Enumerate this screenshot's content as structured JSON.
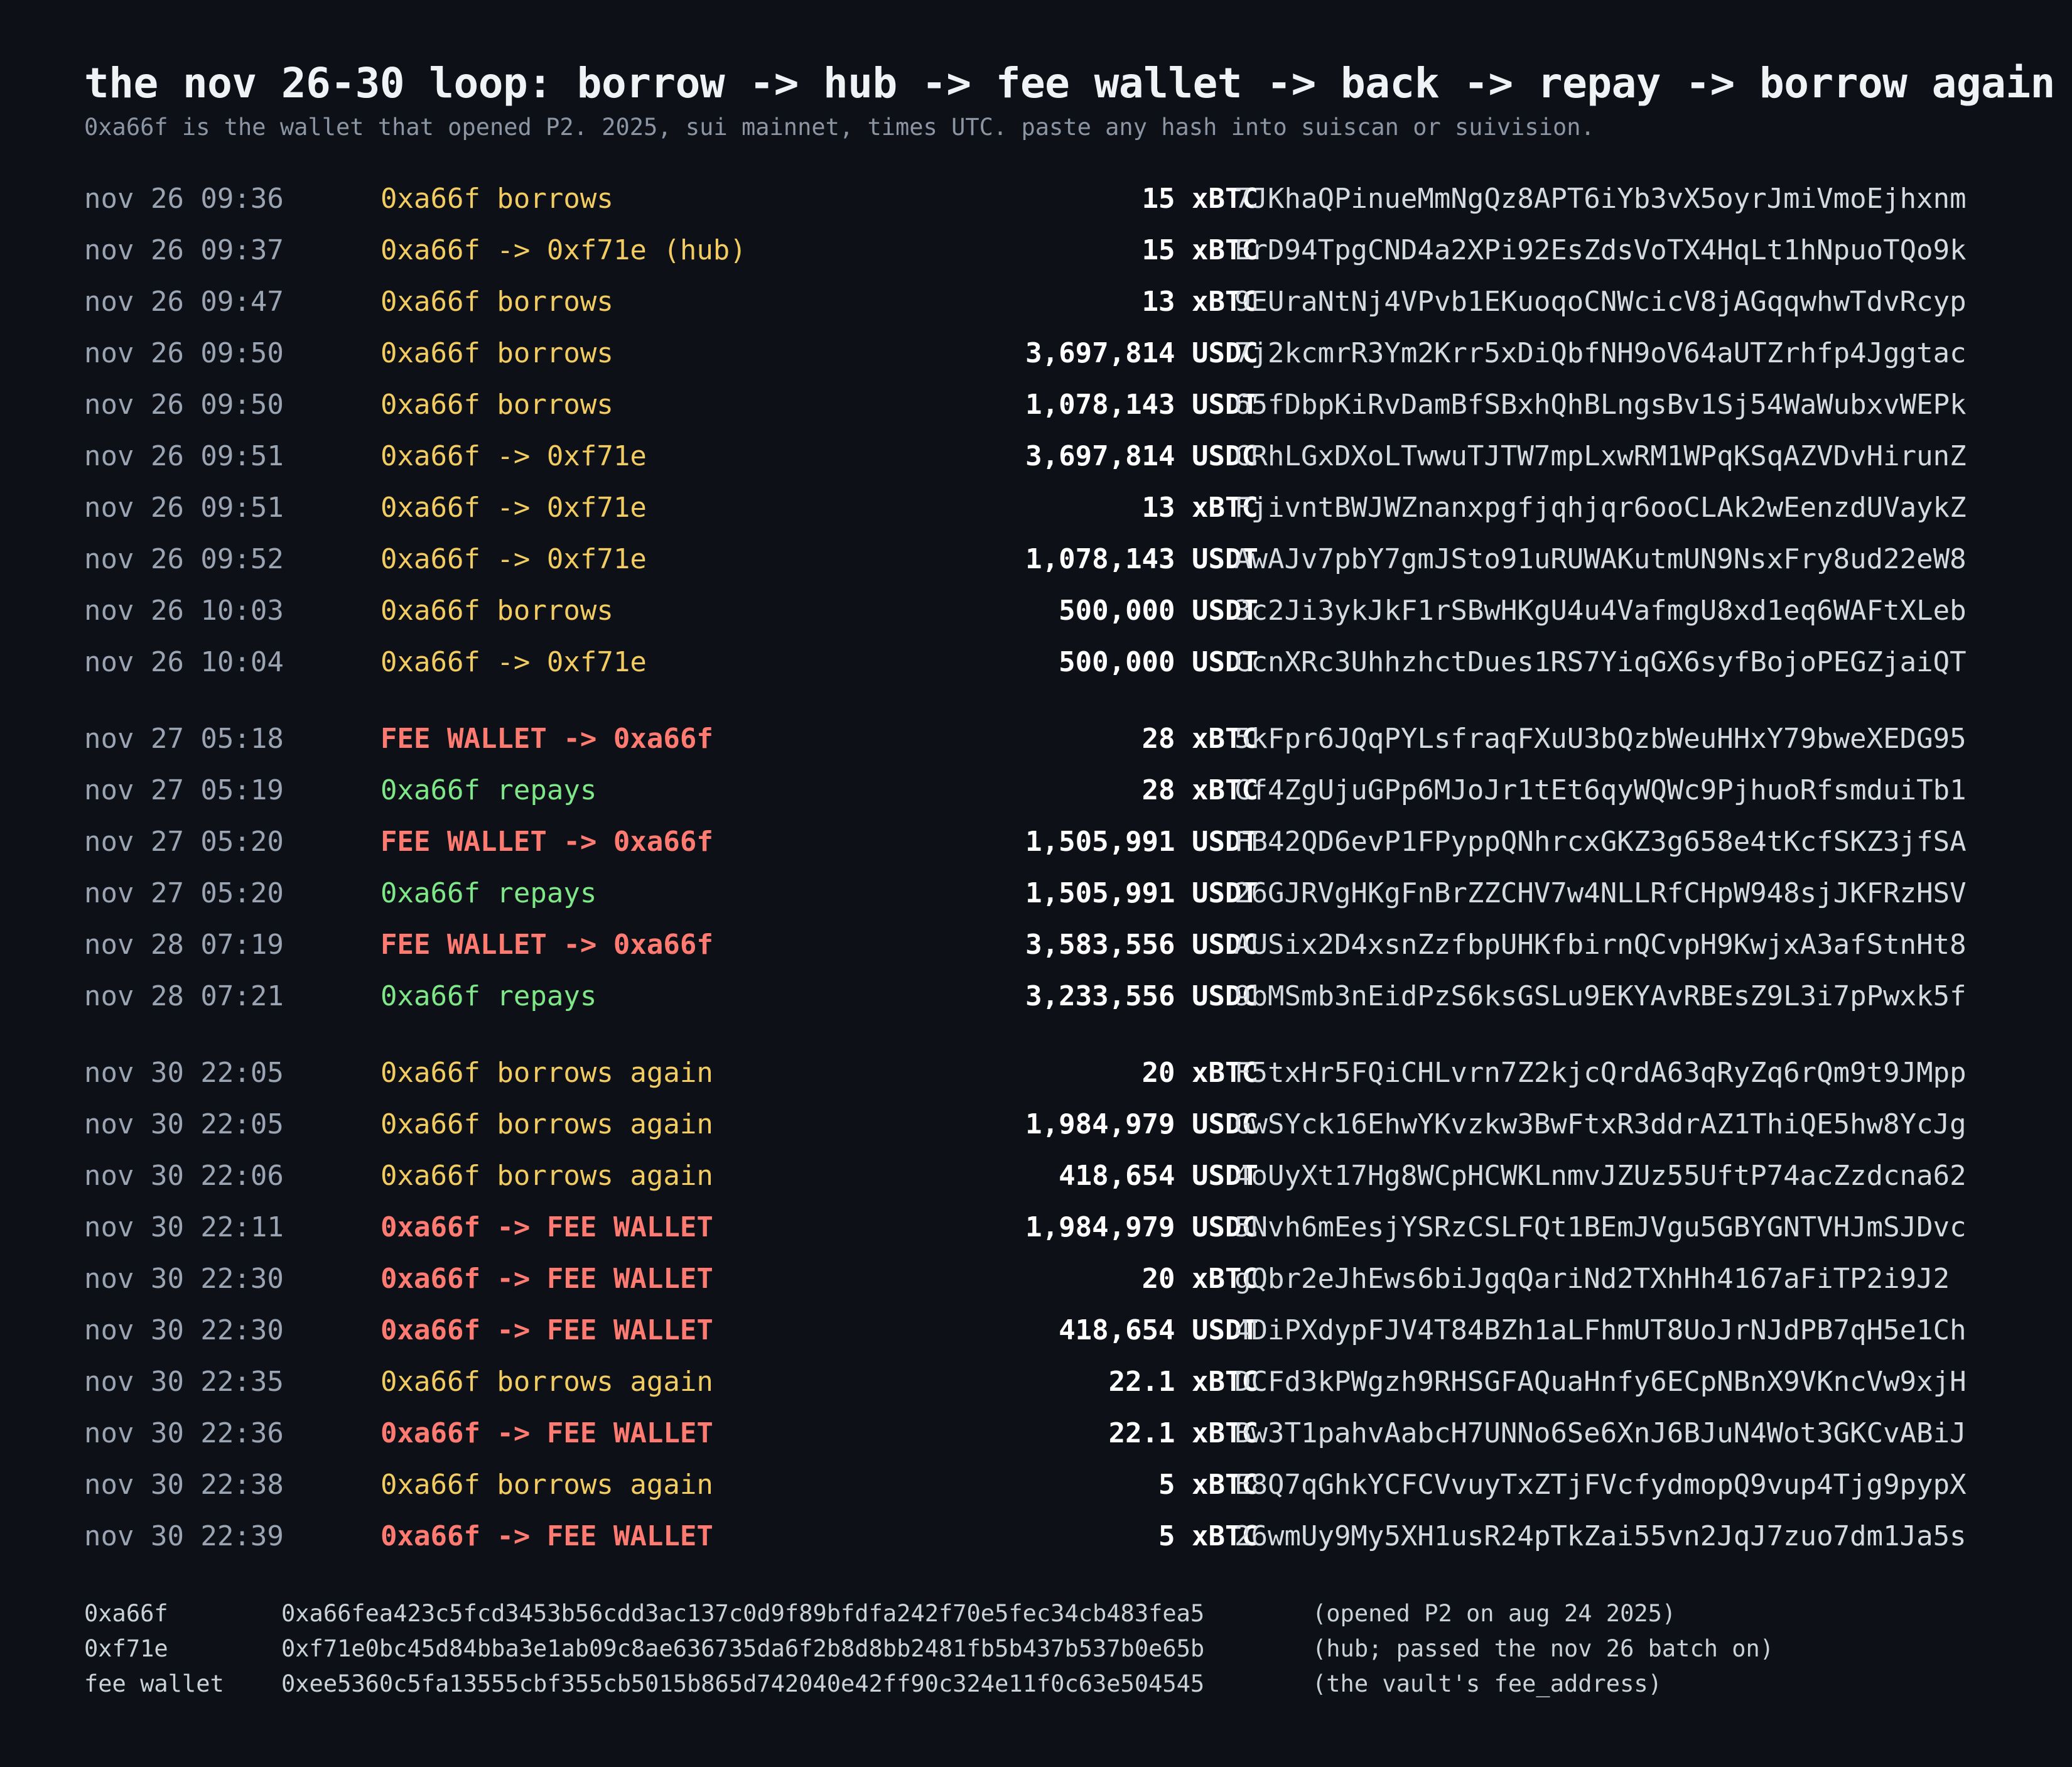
{
  "title": "the nov 26-30 loop: borrow -> hub -> fee wallet -> back -> repay -> borrow again",
  "subtitle": "0xa66f is the wallet that opened P2. 2025, sui mainnet, times UTC. paste any hash into suiscan or suivision.",
  "colors": {
    "background": "#0d1117",
    "borrow": "#f2cc60",
    "repay": "#7ee787",
    "fee_wallet": "#ff7b72",
    "amount": "#ffffff",
    "time": "#9aa4b2"
  },
  "groups": [
    {
      "rows": [
        {
          "time": "nov 26 09:36",
          "desc": "0xa66f borrows",
          "kind": "borrow",
          "amount": "15 xBTC",
          "hash": "7JKhaQPinueMmNgQz8APT6iYb3vX5oyrJmiVmoEjhxnm"
        },
        {
          "time": "nov 26 09:37",
          "desc": "0xa66f -> 0xf71e (hub)",
          "kind": "borrow",
          "amount": "15 xBTC",
          "hash": "ErD94TpgCND4a2XPi92EsZdsVoTX4HqLt1hNpuoTQo9k"
        },
        {
          "time": "nov 26 09:47",
          "desc": "0xa66f borrows",
          "kind": "borrow",
          "amount": "13 xBTC",
          "hash": "9EUraNtNj4VPvb1EKuoqoCNWcicV8jAGqqwhwTdvRcyp"
        },
        {
          "time": "nov 26 09:50",
          "desc": "0xa66f borrows",
          "kind": "borrow",
          "amount": "3,697,814 USDC",
          "hash": "7j2kcmrR3Ym2Krr5xDiQbfNH9oV64aUTZrhfp4Jggtac"
        },
        {
          "time": "nov 26 09:50",
          "desc": "0xa66f borrows",
          "kind": "borrow",
          "amount": "1,078,143 USDT",
          "hash": "65fDbpKiRvDamBfSBxhQhBLngsBv1Sj54WaWubxvWEPk"
        },
        {
          "time": "nov 26 09:51",
          "desc": "0xa66f -> 0xf71e",
          "kind": "borrow",
          "amount": "3,697,814 USDC",
          "hash": "CRhLGxDXoLTwwuTJTW7mpLxwRM1WPqKSqAZVDvHirunZ"
        },
        {
          "time": "nov 26 09:51",
          "desc": "0xa66f -> 0xf71e",
          "kind": "borrow",
          "amount": "13 xBTC",
          "hash": "FjivntBWJWZnanxpgfjqhjqr6ooCLAk2wEenzdUVaykZ"
        },
        {
          "time": "nov 26 09:52",
          "desc": "0xa66f -> 0xf71e",
          "kind": "borrow",
          "amount": "1,078,143 USDT",
          "hash": "AwAJv7pbY7gmJSto91uRUWAKutmUN9NsxFry8ud22eW8"
        },
        {
          "time": "nov 26 10:03",
          "desc": "0xa66f borrows",
          "kind": "borrow",
          "amount": "500,000 USDT",
          "hash": "3c2Ji3ykJkF1rSBwHKgU4u4VafmgU8xd1eq6WAFtXLeb"
        },
        {
          "time": "nov 26 10:04",
          "desc": "0xa66f -> 0xf71e",
          "kind": "borrow",
          "amount": "500,000 USDT",
          "hash": "CcnXRc3UhhzhctDues1RS7YiqGX6syfBojoPEGZjaiQT"
        }
      ]
    },
    {
      "rows": [
        {
          "time": "nov 27 05:18",
          "desc": "FEE WALLET -> 0xa66f",
          "kind": "fee",
          "amount": "28 xBTC",
          "hash": "5kFpr6JQqPYLsfraqFXuU3bQzbWeuHHxY79bweXEDG95"
        },
        {
          "time": "nov 27 05:19",
          "desc": "0xa66f repays",
          "kind": "repay",
          "amount": "28 xBTC",
          "hash": "Cf4ZgUjuGPp6MJoJr1tEt6qyWQWc9PjhuoRfsmduiTb1"
        },
        {
          "time": "nov 27 05:20",
          "desc": "FEE WALLET -> 0xa66f",
          "kind": "fee",
          "amount": "1,505,991 USDT",
          "hash": "FB42QD6evP1FPyppQNhrcxGKZ3g658e4tKcfSKZ3jfSA"
        },
        {
          "time": "nov 27 05:20",
          "desc": "0xa66f repays",
          "kind": "repay",
          "amount": "1,505,991 USDT",
          "hash": "26GJRVgHKgFnBrZZCHV7w4NLLRfCHpW948sjJKFRzHSV"
        },
        {
          "time": "nov 28 07:19",
          "desc": "FEE WALLET -> 0xa66f",
          "kind": "fee",
          "amount": "3,583,556 USDC",
          "hash": "AUSix2D4xsnZzfbpUHKfbirnQCvpH9KwjxA3afStnHt8"
        },
        {
          "time": "nov 28 07:21",
          "desc": "0xa66f repays",
          "kind": "repay",
          "amount": "3,233,556 USDC",
          "hash": "9bMSmb3nEidPzS6ksGSLu9EKYAvRBEsZ9L3i7pPwxk5f"
        }
      ]
    },
    {
      "rows": [
        {
          "time": "nov 30 22:05",
          "desc": "0xa66f borrows again",
          "kind": "borrow",
          "amount": "20 xBTC",
          "hash": "F5txHr5FQiCHLvrn7Z2kjcQrdA63qRyZq6rQm9t9JMpp"
        },
        {
          "time": "nov 30 22:05",
          "desc": "0xa66f borrows again",
          "kind": "borrow",
          "amount": "1,984,979 USDC",
          "hash": "GwSYck16EhwYKvzkw3BwFtxR3ddrAZ1ThiQE5hw8YcJg"
        },
        {
          "time": "nov 30 22:06",
          "desc": "0xa66f borrows again",
          "kind": "borrow",
          "amount": "418,654 USDT",
          "hash": "4oUyXt17Hg8WCpHCWKLnmvJZUz55UftP74acZzdcna62"
        },
        {
          "time": "nov 30 22:11",
          "desc": "0xa66f -> FEE WALLET",
          "kind": "fee",
          "amount": "1,984,979 USDC",
          "hash": "5Nvh6mEesjYSRzCSLFQt1BEmJVgu5GBYGNTVHJmSJDvc"
        },
        {
          "time": "nov 30 22:30",
          "desc": "0xa66f -> FEE WALLET",
          "kind": "fee",
          "amount": "20 xBTC",
          "hash": "gQbr2eJhEws6biJgqQariNd2TXhHh4167aFiTP2i9J2"
        },
        {
          "time": "nov 30 22:30",
          "desc": "0xa66f -> FEE WALLET",
          "kind": "fee",
          "amount": "418,654 USDT",
          "hash": "4DiPXdypFJV4T84BZh1aLFhmUT8UoJrNJdPB7qH5e1Ch"
        },
        {
          "time": "nov 30 22:35",
          "desc": "0xa66f borrows again",
          "kind": "borrow",
          "amount": "22.1 xBTC",
          "hash": "DCFd3kPWgzh9RHSGFAQuaHnfy6ECpNBnX9VKncVw9xjH"
        },
        {
          "time": "nov 30 22:36",
          "desc": "0xa66f -> FEE WALLET",
          "kind": "fee",
          "amount": "22.1 xBTC",
          "hash": "Bw3T1pahvAabcH7UNNo6Se6XnJ6BJuN4Wot3GKCvABiJ"
        },
        {
          "time": "nov 30 22:38",
          "desc": "0xa66f borrows again",
          "kind": "borrow",
          "amount": "5 xBTC",
          "hash": "E8Q7qGhkYCFCVvuyTxZTjFVcfydmopQ9vup4Tjg9pypX"
        },
        {
          "time": "nov 30 22:39",
          "desc": "0xa66f -> FEE WALLET",
          "kind": "fee",
          "amount": "5 xBTC",
          "hash": "26wmUy9My5XH1usR24pTkZai55vn2JqJ7zuo7dm1Ja5s"
        }
      ]
    }
  ],
  "legend": [
    {
      "label": "0xa66f",
      "address": "0xa66fea423c5fcd3453b56cdd3ac137c0d9f89bfdfa242f70e5fec34cb483fea5",
      "note": "(opened P2 on aug 24 2025)"
    },
    {
      "label": "0xf71e",
      "address": "0xf71e0bc45d84bba3e1ab09c8ae636735da6f2b8d8bb2481fb5b437b537b0e65b",
      "note": "(hub; passed the nov 26 batch on)"
    },
    {
      "label": "fee wallet",
      "address": "0xee5360c5fa13555cbf355cb5015b865d742040e42ff90c324e11f0c63e504545",
      "note": "(the vault's fee_address)"
    }
  ]
}
